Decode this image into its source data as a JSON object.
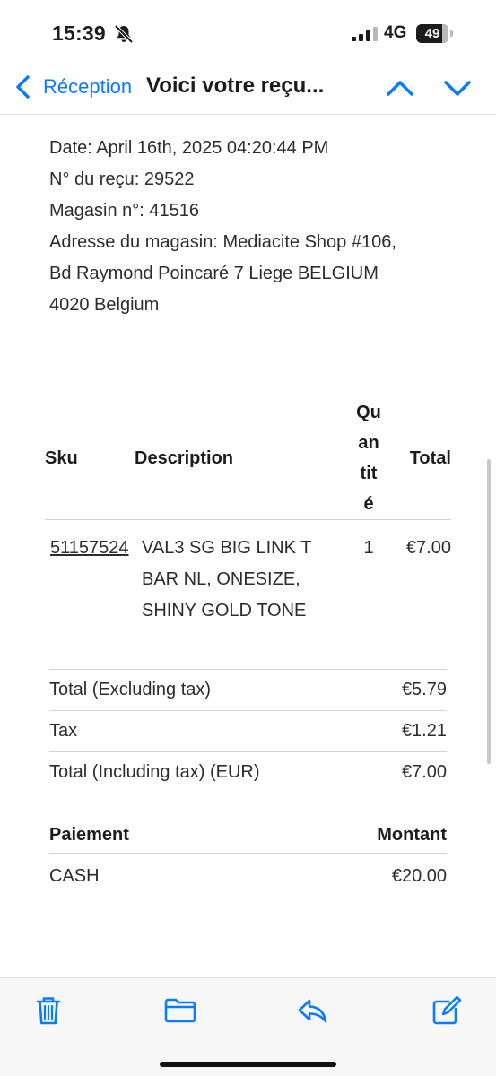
{
  "status_bar": {
    "time": "15:39",
    "network": "4G",
    "battery": "49"
  },
  "nav": {
    "back_label": "Réception",
    "title": "Voici votre reçu..."
  },
  "receipt": {
    "lines": [
      "Date: April 16th, 2025 04:20:44 PM",
      "N° du reçu: 29522",
      "Magasin n°: 41516",
      "Adresse du magasin: Mediacite Shop #106,",
      "Bd Raymond Poincaré 7 Liege BELGIUM",
      "4020 Belgium"
    ]
  },
  "items_table": {
    "headers": {
      "sku": "Sku",
      "description": "Description",
      "quantity_lines": [
        "Qu",
        "an",
        "tit",
        "é"
      ],
      "total": "Total"
    },
    "rows": [
      {
        "sku": "51157524",
        "description_lines": [
          "VAL3 SG BIG LINK T",
          "BAR NL, ONESIZE,",
          "SHINY GOLD TONE"
        ],
        "quantity": "1",
        "total": "€7.00"
      }
    ]
  },
  "summary": [
    {
      "label": "Total (Excluding tax)",
      "value": "€5.79"
    },
    {
      "label": "Tax",
      "value": "€1.21"
    },
    {
      "label": "Total (Including tax) (EUR)",
      "value": "€7.00"
    }
  ],
  "payment": {
    "header_method": "Paiement",
    "header_amount": "Montant",
    "rows": [
      {
        "method": "CASH",
        "amount": "€20.00"
      }
    ]
  },
  "toolbar": {
    "icons": [
      "trash-icon",
      "folder-icon",
      "reply-icon",
      "compose-icon"
    ]
  },
  "colors": {
    "accent": "#0a7aff",
    "text": "#1c1c1e",
    "divider": "#d1d1d6"
  }
}
